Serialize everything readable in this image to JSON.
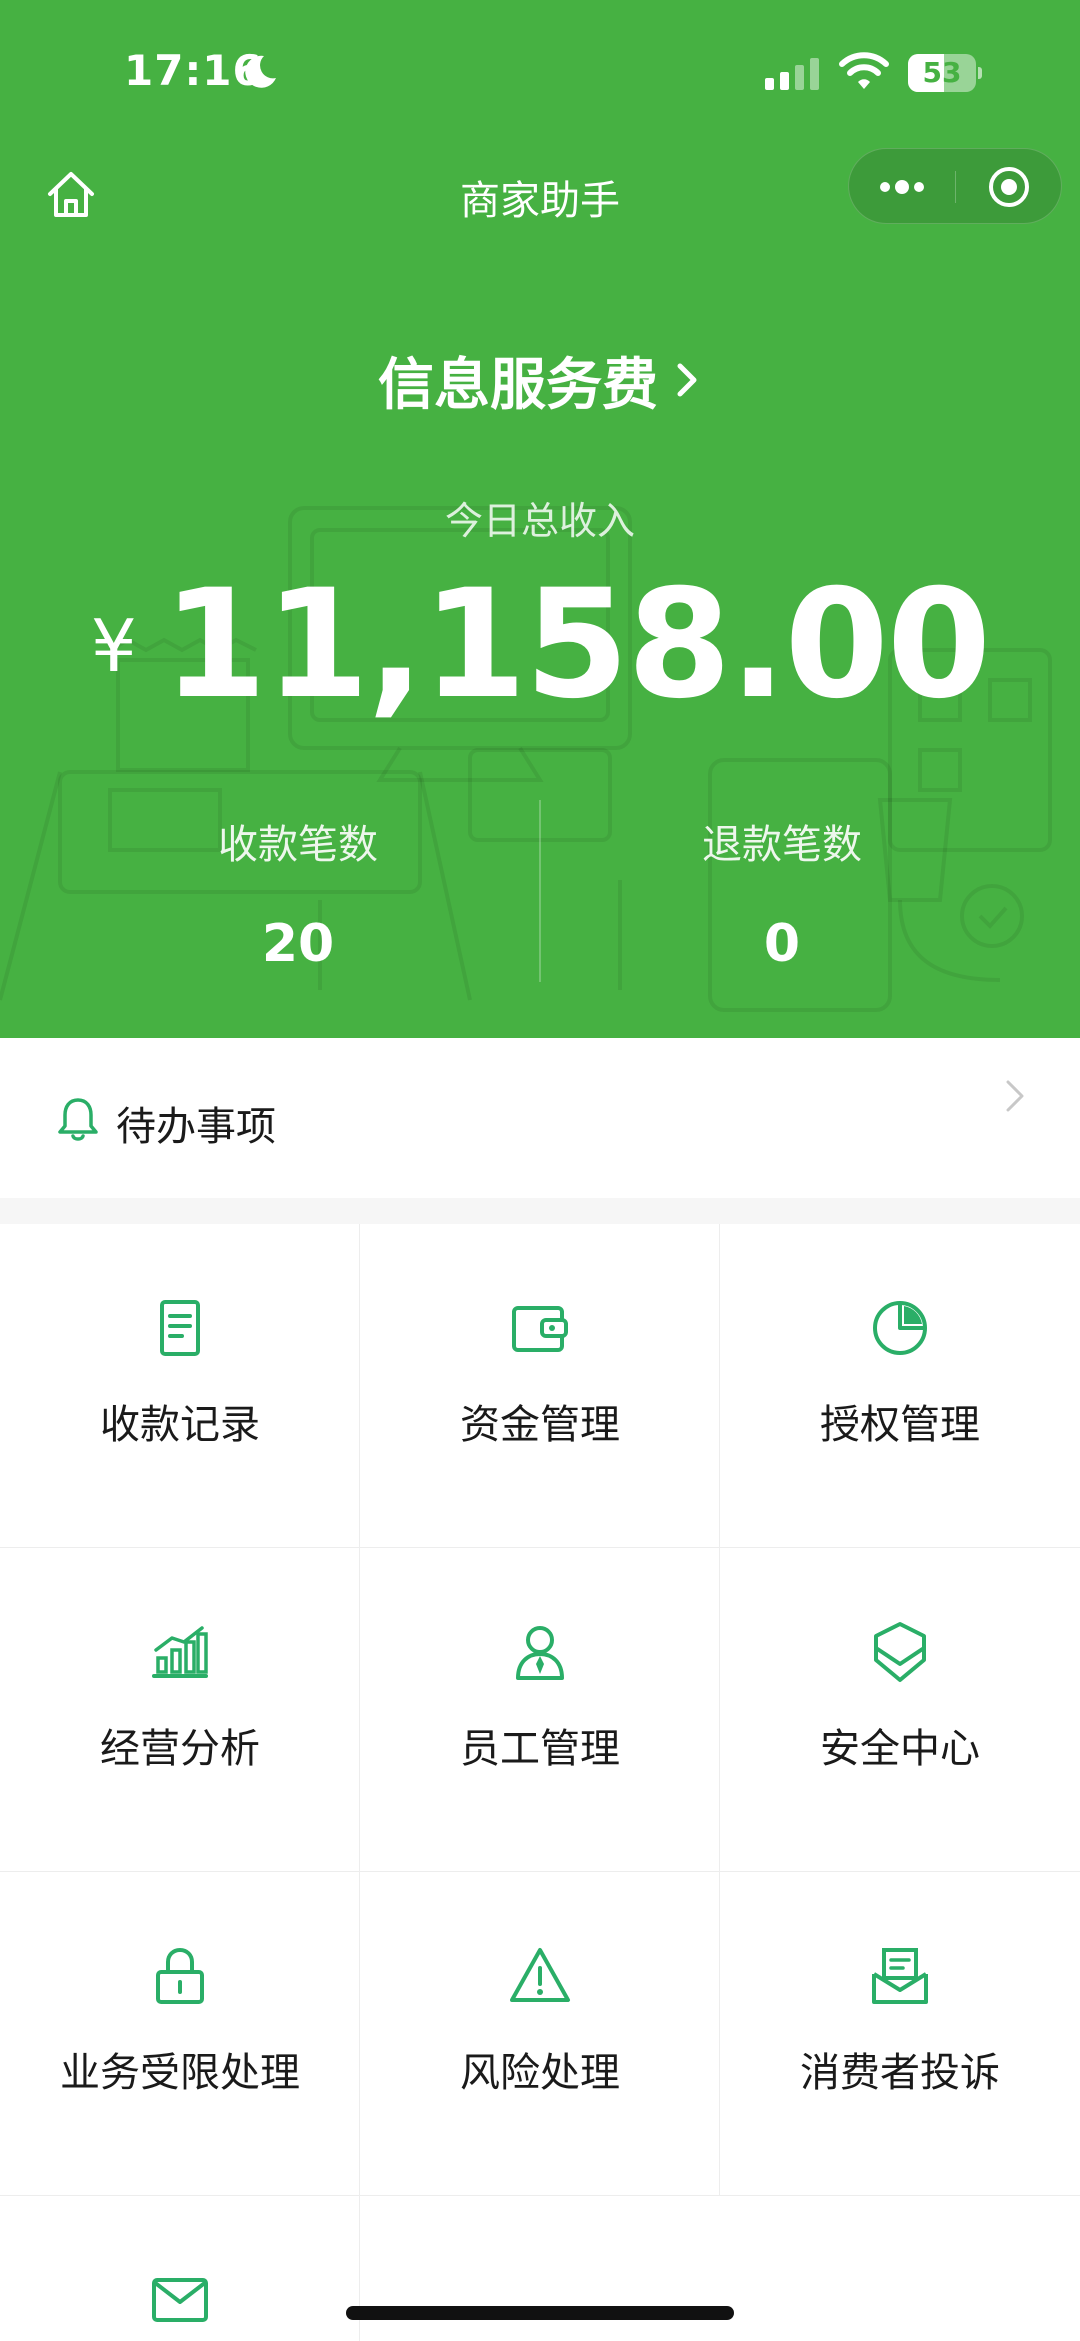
{
  "status_bar": {
    "time": "17:16",
    "battery": "53",
    "battery_level": 0.53
  },
  "nav": {
    "title": "商家助手"
  },
  "header": {
    "service_fee": "信息服务费",
    "income_label": "今日总收入",
    "currency": "¥",
    "amount": "11,158.00",
    "stats": [
      {
        "label": "收款笔数",
        "value": "20"
      },
      {
        "label": "退款笔数",
        "value": "0"
      }
    ]
  },
  "todo": {
    "label": "待办事项"
  },
  "grid": {
    "items": [
      {
        "label": "收款记录",
        "icon": "receipt-icon"
      },
      {
        "label": "资金管理",
        "icon": "wallet-icon"
      },
      {
        "label": "授权管理",
        "icon": "pie-chart-icon"
      },
      {
        "label": "经营分析",
        "icon": "bar-chart-icon"
      },
      {
        "label": "员工管理",
        "icon": "staff-icon"
      },
      {
        "label": "安全中心",
        "icon": "shield-icon"
      },
      {
        "label": "业务受限处理",
        "icon": "lock-icon"
      },
      {
        "label": "风险处理",
        "icon": "warning-icon"
      },
      {
        "label": "消费者投诉",
        "icon": "complaint-icon"
      },
      {
        "label": "",
        "icon": "mail-icon"
      }
    ]
  },
  "colors": {
    "brand_green": "#46b142",
    "icon_green": "#2aae67"
  }
}
